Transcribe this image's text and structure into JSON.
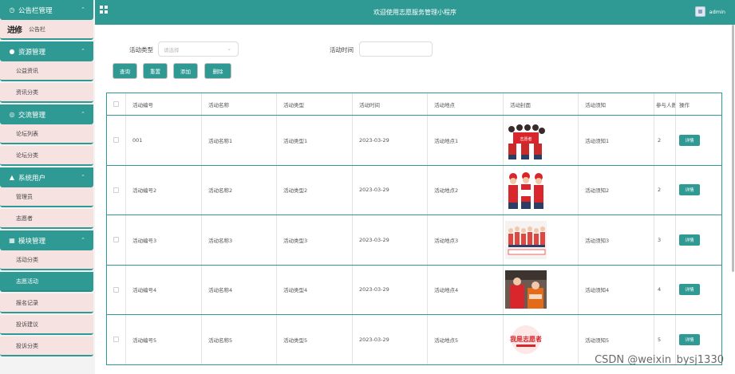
{
  "app": {
    "title": "欢迎使用志愿服务管理小程序",
    "user": "admin",
    "primary_color": "#2f9a93",
    "menu_item_bg": "#f7e2e2"
  },
  "sidebar": {
    "groups": [
      {
        "label": "公告栏管理",
        "icon": "clock-icon",
        "items": [
          {
            "label": "公告栏",
            "stamp": "进修"
          }
        ]
      },
      {
        "label": "资源管理",
        "icon": "bulb-icon",
        "items": [
          {
            "label": "公益资讯"
          },
          {
            "label": "资讯分类"
          }
        ]
      },
      {
        "label": "交流管理",
        "icon": "chat-icon",
        "items": [
          {
            "label": "论坛列表"
          },
          {
            "label": "论坛分类"
          }
        ]
      },
      {
        "label": "系统用户",
        "icon": "user-icon",
        "items": [
          {
            "label": "管理员"
          },
          {
            "label": "志愿者"
          }
        ]
      },
      {
        "label": "模块管理",
        "icon": "grid-icon",
        "items": [
          {
            "label": "活动分类"
          },
          {
            "label": "志愿活动",
            "active": true
          },
          {
            "label": "报名记录"
          },
          {
            "label": "投诉建议"
          },
          {
            "label": "投诉分类"
          }
        ]
      }
    ]
  },
  "search": {
    "type_label": "活动类型",
    "type_placeholder": "请选择",
    "time_label": "活动时间",
    "time_placeholder": ""
  },
  "buttons": {
    "query": "查询",
    "reset": "重置",
    "add": "添加",
    "delete": "删除"
  },
  "table": {
    "columns": [
      "活动编号",
      "活动名称",
      "活动类型",
      "活动时间",
      "活动地点",
      "活动封面",
      "活动须知",
      "参与人数",
      "操作"
    ],
    "detail_label": "详情",
    "rows": [
      {
        "code": "001",
        "name": "活动名称1",
        "type": "活动类型1",
        "time": "2023-03-29",
        "place": "活动地点1",
        "notice": "活动须知1",
        "count": "2"
      },
      {
        "code": "活动编号2",
        "name": "活动名称2",
        "type": "活动类型2",
        "time": "2023-03-29",
        "place": "活动地点2",
        "notice": "活动须知2",
        "count": "2"
      },
      {
        "code": "活动编号3",
        "name": "活动名称3",
        "type": "活动类型3",
        "time": "2023-03-29",
        "place": "活动地点3",
        "notice": "活动须知3",
        "count": "3"
      },
      {
        "code": "活动编号4",
        "name": "活动名称4",
        "type": "活动类型4",
        "time": "2023-03-29",
        "place": "活动地点4",
        "notice": "活动须知4",
        "count": "4"
      },
      {
        "code": "活动编号5",
        "name": "活动名称5",
        "type": "活动类型5",
        "time": "2023-03-29",
        "place": "活动地点5",
        "notice": "活动须知5",
        "count": "5"
      }
    ]
  },
  "watermark": "CSDN @weixin_bysj1330"
}
